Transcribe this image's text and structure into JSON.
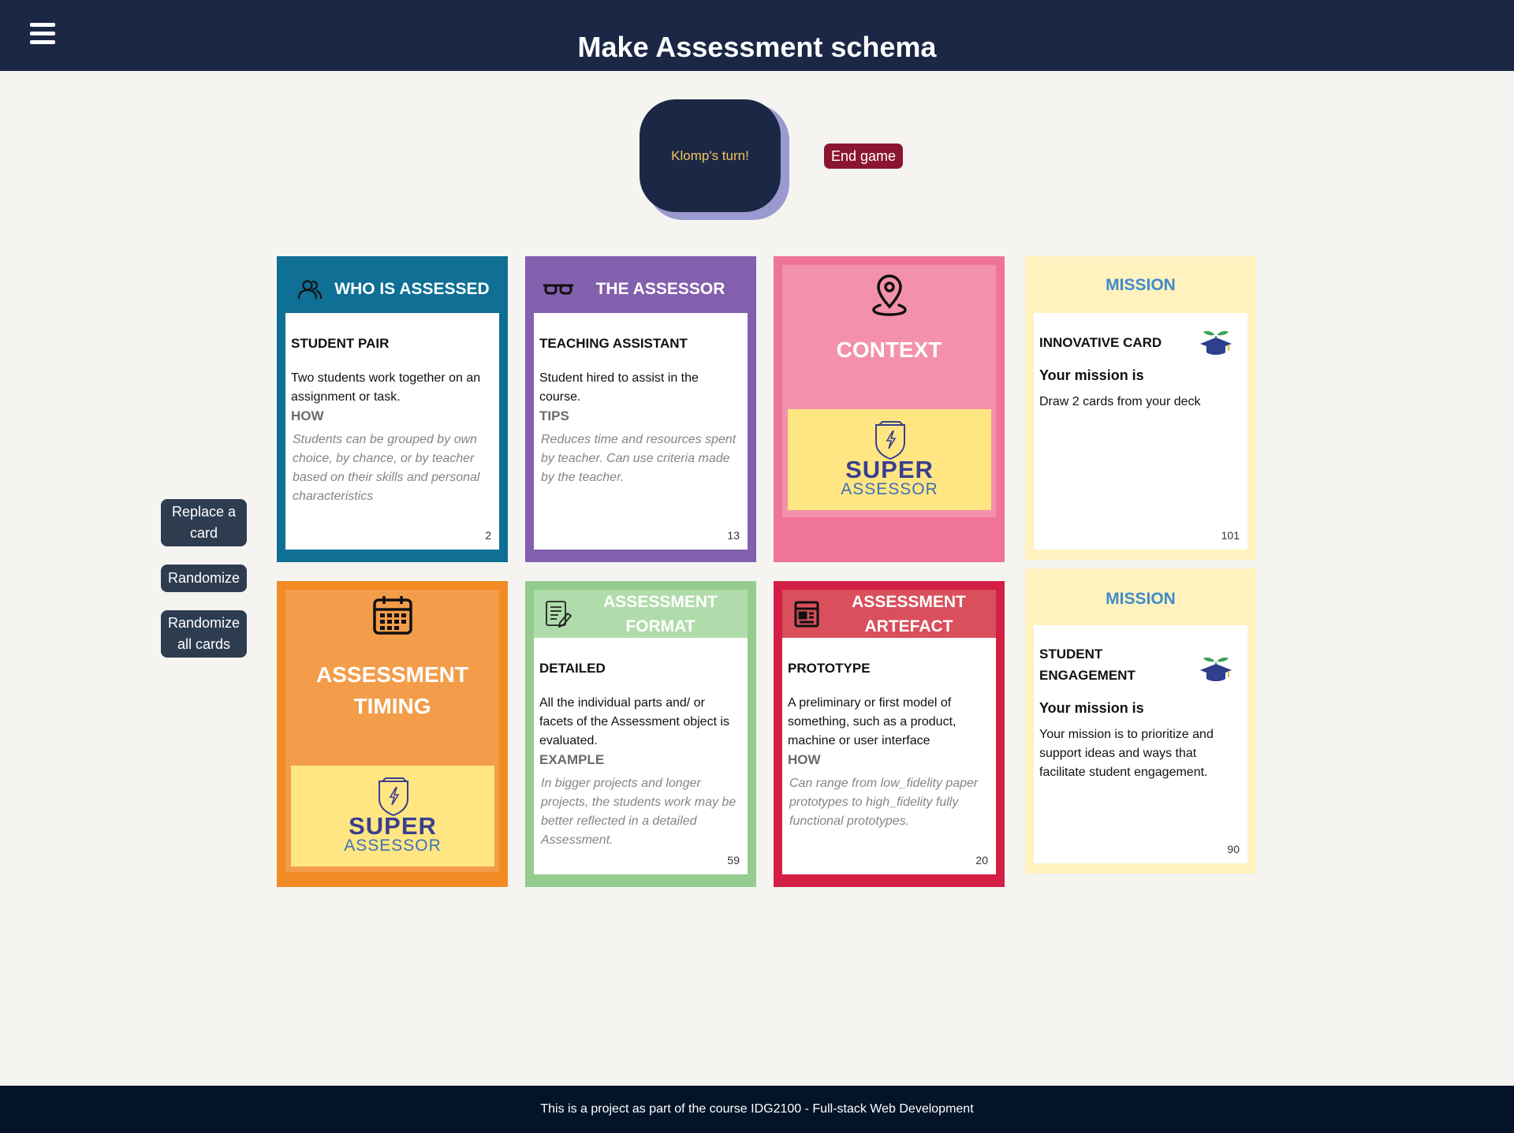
{
  "header": {
    "title": "Make Assessment schema"
  },
  "turn": {
    "label": "Klomp's turn!",
    "end_game_label": "End game"
  },
  "sidebar": {
    "replace_label": "Replace a card",
    "randomize_label": "Randomize",
    "randomize_all_label": "Randomize all cards"
  },
  "logo": {
    "line1": "SUPER",
    "line2": "ASSESSOR"
  },
  "cards": {
    "who": {
      "header": "WHO IS ASSESSED",
      "title": "STUDENT PAIR",
      "description": "Two students work together on an assignment or task.",
      "sub_label": "HOW",
      "sub_text": "Students can be grouped by own choice, by chance, or by teacher based on their skills and personal characteristics",
      "number": "2",
      "color": "#0f6f94"
    },
    "assessor": {
      "header": "THE ASSESSOR",
      "title": "TEACHING ASSISTANT",
      "description": "Student hired to assist in the course.",
      "sub_label": "TIPS",
      "sub_text": "Reduces time and resources spent by teacher. Can use criteria made by the teacher.",
      "number": "13",
      "color": "#8360ad"
    },
    "context": {
      "title": "CONTEXT",
      "color": "#f0739a"
    },
    "timing": {
      "title": "ASSESSMENT TIMING",
      "color": "#f28b24"
    },
    "format": {
      "header": "ASSESSMENT FORMAT",
      "title": "DETAILED",
      "description": "All the individual parts and/ or facets of the Assessment object is evaluated.",
      "sub_label": "EXAMPLE",
      "sub_text": "In bigger projects and longer projects, the students work may be better reflected in a detailed Assessment.",
      "number": "59",
      "color": "#93cc8e"
    },
    "artefact": {
      "header": "ASSESSMENT ARTEFACT",
      "title": "PROTOTYPE",
      "description": "A preliminary or first model of something, such as a product, machine or user interface",
      "sub_label": "HOW",
      "sub_text": "Can range from low_fidelity paper prototypes to high_fidelity fully functional prototypes.",
      "number": "20",
      "color": "#d41f45"
    },
    "mission1": {
      "header": "MISSION",
      "title": "INNOVATIVE CARD",
      "mission_label": "Your mission is",
      "description": "Draw 2 cards from your deck",
      "number": "101"
    },
    "mission2": {
      "header": "MISSION",
      "title": "STUDENT ENGAGEMENT",
      "mission_label": "Your mission is",
      "description": "Your mission is to prioritize and support ideas and ways that facilitate student engagement.",
      "number": "90"
    }
  },
  "footer": {
    "text": "This is a project as part of the course IDG2100 - Full-stack Web Development"
  }
}
